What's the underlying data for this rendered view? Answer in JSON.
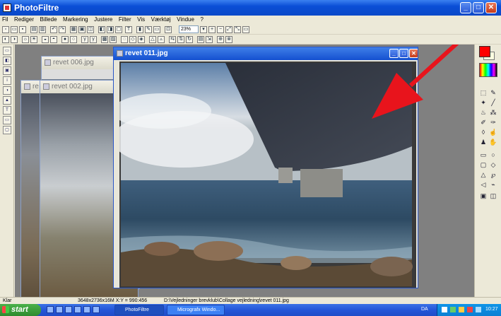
{
  "app": {
    "title": "PhotoFiltre"
  },
  "menu": [
    "Fil",
    "Rediger",
    "Billede",
    "Markering",
    "Justere",
    "Filter",
    "Vis",
    "Værktøj",
    "Vindue",
    "?"
  ],
  "toolbar": {
    "zoom": "23%"
  },
  "documents": [
    {
      "title": "revet 006.jpg"
    },
    {
      "title": "re"
    },
    {
      "title": "revet 002.jpg"
    },
    {
      "title": "revet 011.jpg"
    }
  ],
  "status": {
    "ready": "Klar",
    "info": "3648x2736x16M  X:Y = 990:456",
    "path": "D:\\Vejledninger brevklub\\Collage vejledning\\revet 011.jpg"
  },
  "taskbar": {
    "start": "start",
    "tasks": [
      "PhotoFiltre",
      "Micrografx Windo..."
    ],
    "lang": "DA",
    "time": "10:27"
  },
  "colors": {
    "foreground": "#ff0000",
    "background": "#ffffe0",
    "annotation_arrow": "#e8141c"
  }
}
